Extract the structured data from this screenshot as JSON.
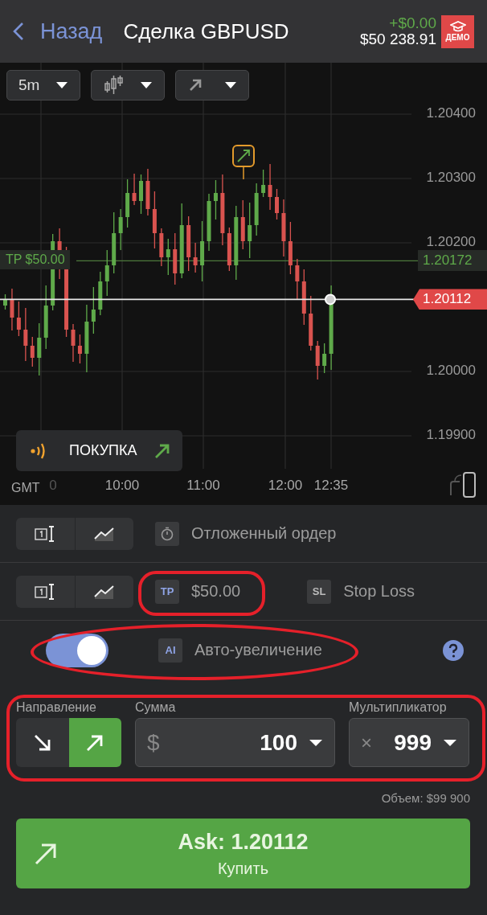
{
  "header": {
    "back_label": "Назад",
    "title": "Сделка GBPUSD",
    "profit": "+$0.00",
    "balance": "$50 238.91",
    "badge": "ДЕМО"
  },
  "chart_toolbar": [
    {
      "kind": "text",
      "label": "5m"
    },
    {
      "kind": "candles"
    },
    {
      "kind": "trend"
    }
  ],
  "chart": {
    "price_ticks": [
      "1.20400",
      "1.20300",
      "1.20200",
      "1.20000",
      "1.19900"
    ],
    "time_ticks": [
      "0",
      "10:00",
      "11:00",
      "12:00",
      "12:35"
    ],
    "timezone": "GMT",
    "tp_label": "TP $50.00",
    "tp_price": "1.20172",
    "current_price": "1.20112",
    "signal_label": "ПОКУПКА"
  },
  "pending_order": {
    "label": "Отложенный ордер"
  },
  "limits": {
    "tp_badge": "TP",
    "tp_value": "$50.00",
    "sl_badge": "SL",
    "sl_label": "Stop Loss"
  },
  "auto_increase": {
    "on": true,
    "badge": "AI",
    "label": "Авто-увеличение"
  },
  "direction": {
    "label": "Направление",
    "buttons": [
      {
        "kind": "sell",
        "selected": false
      },
      {
        "kind": "buy",
        "selected": true
      }
    ]
  },
  "amount": {
    "label": "Сумма",
    "currency": "$",
    "value": "100"
  },
  "multiplier": {
    "label": "Мультипликатор",
    "sign": "×",
    "value": "999"
  },
  "volume": "Объем: $99 900",
  "buy_button": {
    "price": "Ask: 1.20112",
    "label": "Купить"
  }
}
